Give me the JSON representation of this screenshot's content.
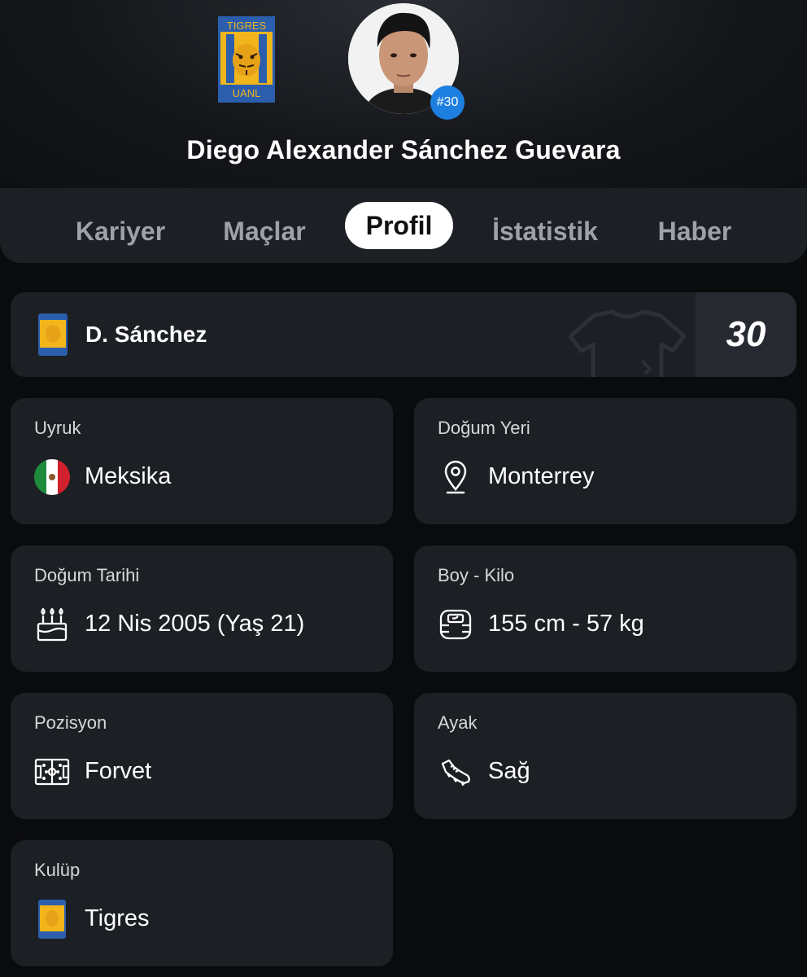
{
  "header": {
    "player_name": "Diego Alexander Sánchez Guevara",
    "shirt_badge": "#30",
    "club_logo_text_top": "TIGRES",
    "club_logo_text_bottom": "UANL"
  },
  "tabs": [
    {
      "label": "Kariyer",
      "active": false
    },
    {
      "label": "Maçlar",
      "active": false
    },
    {
      "label": "Profil",
      "active": true
    },
    {
      "label": "İstatistik",
      "active": false
    },
    {
      "label": "Haber",
      "active": false
    }
  ],
  "shirt_card": {
    "short_name": "D. Sánchez",
    "number": "30"
  },
  "info": {
    "nationality": {
      "label": "Uyruk",
      "value": "Meksika",
      "icon": "mexico-flag-icon"
    },
    "birthplace": {
      "label": "Doğum Yeri",
      "value": "Monterrey",
      "icon": "location-pin-icon"
    },
    "birthdate": {
      "label": "Doğum Tarihi",
      "value": "12 Nis 2005 (Yaş 21)",
      "icon": "birthday-cake-icon"
    },
    "height_weight": {
      "label": "Boy - Kilo",
      "value": "155 cm - 57 kg",
      "icon": "scale-icon"
    },
    "position": {
      "label": "Pozisyon",
      "value": "Forvet",
      "icon": "pitch-icon"
    },
    "foot": {
      "label": "Ayak",
      "value": "Sağ",
      "icon": "football-boot-icon"
    },
    "club": {
      "label": "Kulüp",
      "value": "Tigres",
      "icon": "club-logo-icon"
    }
  },
  "colors": {
    "background": "#0a0b0d",
    "card": "#1c1f24",
    "accent_badge": "#1d7fe0",
    "club_gold": "#f2b51c",
    "club_blue": "#2b5fae"
  }
}
